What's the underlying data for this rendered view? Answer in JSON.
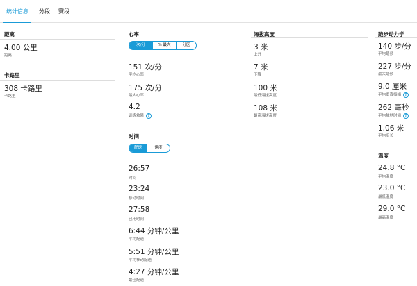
{
  "tabs": [
    "统计信息",
    "分段",
    "赛段"
  ],
  "icons": {
    "info": "question-circle-icon"
  },
  "colors": {
    "accent": "#1a9bd7"
  },
  "distance": {
    "title": "距离",
    "items": [
      {
        "value": "4.00 公里",
        "label": "距离"
      }
    ]
  },
  "calories": {
    "title": "卡路里",
    "items": [
      {
        "value": "308 卡路里",
        "label": "卡路里"
      }
    ]
  },
  "heart_rate": {
    "title": "心率",
    "toggle": [
      "次/分",
      "% 最大",
      "分区"
    ],
    "items": [
      {
        "value": "151 次/分",
        "label": "平均心率"
      },
      {
        "value": "175 次/分",
        "label": "最大心率"
      },
      {
        "value": "4.2",
        "label": "训练效果"
      }
    ]
  },
  "time": {
    "title": "时间",
    "toggle": [
      "配速",
      "速度"
    ],
    "items": [
      {
        "value": "26:57",
        "label": "时间"
      },
      {
        "value": "23:24",
        "label": "移动时间"
      },
      {
        "value": "27:58",
        "label": "已用时间"
      },
      {
        "value": "6:44 分钟/公里",
        "label": "平均配速"
      },
      {
        "value": "5:51 分钟/公里",
        "label": "平均移动配速"
      },
      {
        "value": "4:27 分钟/公里",
        "label": "最佳配速"
      }
    ]
  },
  "elevation": {
    "title": "海拔高度",
    "items": [
      {
        "value": "3 米",
        "label": "上升"
      },
      {
        "value": "7 米",
        "label": "下降"
      },
      {
        "value": "100 米",
        "label": "最低海拔高度"
      },
      {
        "value": "108 米",
        "label": "最高海拔高度"
      }
    ]
  },
  "running_dynamics": {
    "title": "跑步动力学",
    "items": [
      {
        "value": "140 步/分",
        "label": "平均踏频"
      },
      {
        "value": "227 步/分",
        "label": "最大踏频"
      },
      {
        "value": "9.0 厘米",
        "label": "平均垂直振幅"
      },
      {
        "value": "262 毫秒",
        "label": "平均触地时间"
      },
      {
        "value": "1.06 米",
        "label": "平均步长"
      }
    ]
  },
  "temperature": {
    "title": "温度",
    "items": [
      {
        "value": "24.8 °C",
        "label": "平均温度"
      },
      {
        "value": "23.0 °C",
        "label": "最低温度"
      },
      {
        "value": "29.0 °C",
        "label": "最高温度"
      }
    ]
  }
}
